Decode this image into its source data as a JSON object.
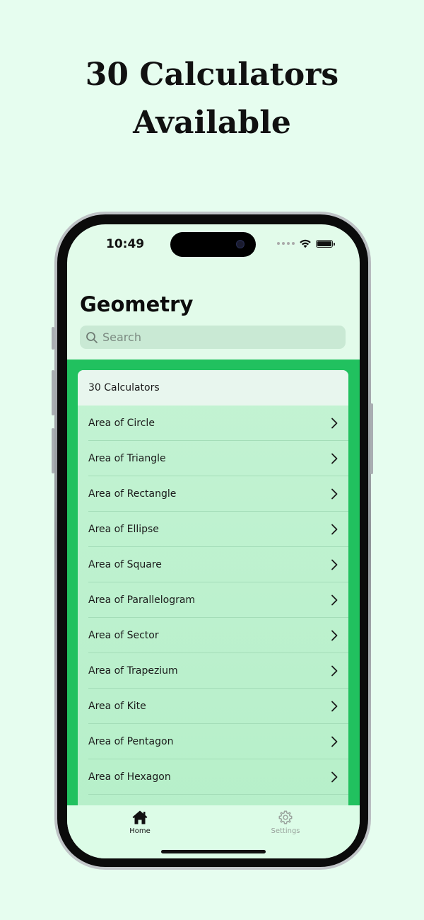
{
  "headline": {
    "line1": "30 Calculators",
    "line2": "Available"
  },
  "status_bar": {
    "time": "10:49"
  },
  "nav": {
    "title": "Geometry"
  },
  "search": {
    "placeholder": "Search",
    "value": ""
  },
  "list": {
    "header": "30 Calculators",
    "items": [
      {
        "label": "Area of Circle"
      },
      {
        "label": "Area of Triangle"
      },
      {
        "label": "Area of Rectangle"
      },
      {
        "label": "Area of Ellipse"
      },
      {
        "label": "Area of Square"
      },
      {
        "label": "Area of Parallelogram"
      },
      {
        "label": "Area of Sector"
      },
      {
        "label": "Area of Trapezium"
      },
      {
        "label": "Area of Kite"
      },
      {
        "label": "Area of Pentagon"
      },
      {
        "label": "Area of Hexagon"
      }
    ]
  },
  "tabbar": {
    "tabs": [
      {
        "label": "Home",
        "icon": "house-icon",
        "selected": true
      },
      {
        "label": "Settings",
        "icon": "gear-icon",
        "selected": false
      }
    ]
  },
  "colors": {
    "page_background": "#e6fdef",
    "content_background": "#21c15f",
    "list_row": "#bff2d0",
    "tab_active": "#111111",
    "tab_inactive": "#9aa39d"
  }
}
